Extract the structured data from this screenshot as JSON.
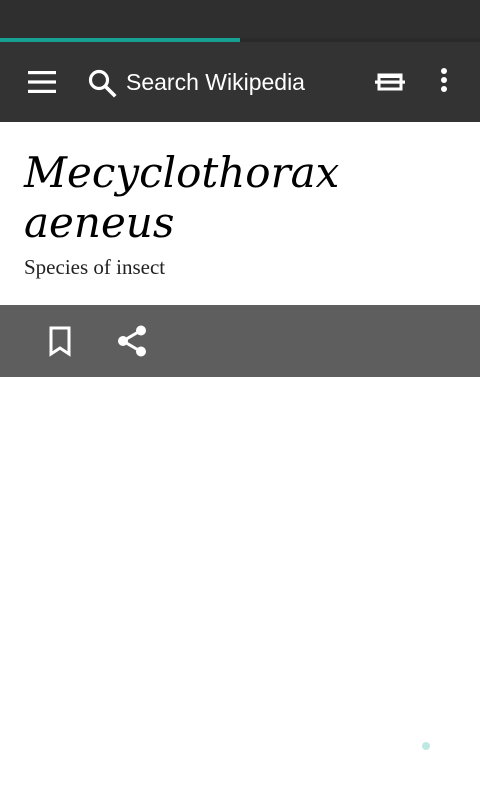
{
  "toolbar": {
    "search_label": "Search Wikipedia",
    "icons": {
      "menu": "hamburger-menu-icon",
      "search": "search-icon",
      "reading_lists": "reading-list-icon",
      "overflow": "more-vertical-icon"
    }
  },
  "progress": {
    "fraction": 0.5,
    "color": "#15a193"
  },
  "article": {
    "title": "Mecyclothorax aeneus",
    "description": "Species of insect"
  },
  "actions": {
    "icons": {
      "bookmark": "bookmark-icon",
      "share": "share-icon"
    }
  },
  "colors": {
    "status_bar": "#2f2f2f",
    "toolbar": "#333333",
    "action_bar": "#5e5e5e",
    "accent": "#15a193"
  }
}
